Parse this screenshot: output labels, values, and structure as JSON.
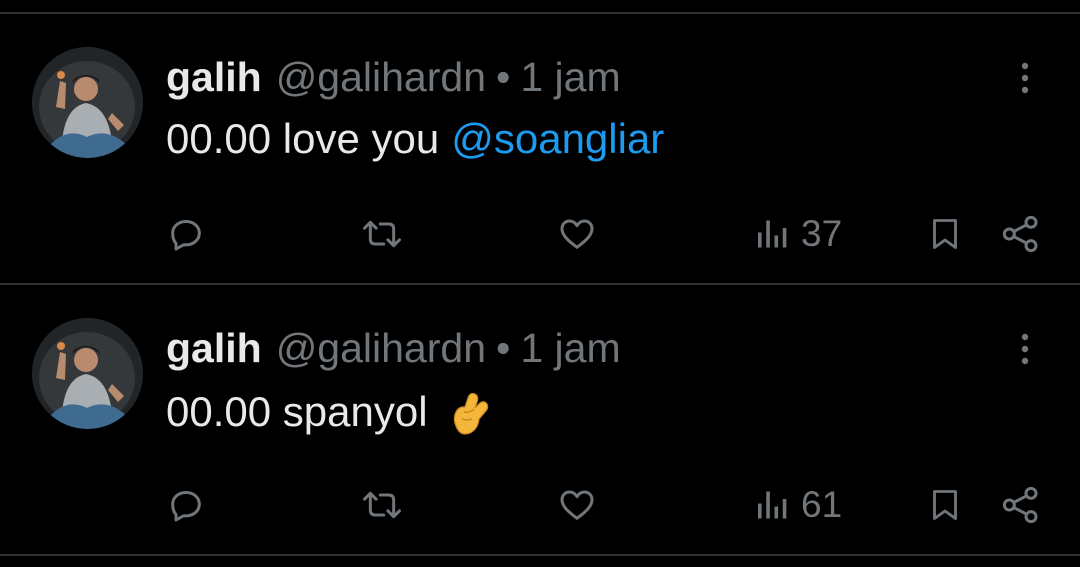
{
  "colors": {
    "background": "#000000",
    "text_primary": "#e7e9ea",
    "text_secondary": "#71767b",
    "accent": "#1d9bf0",
    "divider": "#2f3336"
  },
  "tweets": [
    {
      "author_name": "galih",
      "handle": "@galihardn",
      "separator": "•",
      "time": "1 jam",
      "text": "00.00 love you",
      "mention": "@soangliar",
      "emoji": "",
      "views": "37",
      "icons": [
        "reply-icon",
        "retweet-icon",
        "like-icon",
        "views-icon",
        "bookmark-icon",
        "share-icon",
        "more-icon"
      ]
    },
    {
      "author_name": "galih",
      "handle": "@galihardn",
      "separator": "•",
      "time": "1 jam",
      "text": "00.00 spanyol",
      "mention": "",
      "emoji": "🫰",
      "views": "61",
      "icons": [
        "reply-icon",
        "retweet-icon",
        "like-icon",
        "views-icon",
        "bookmark-icon",
        "share-icon",
        "more-icon"
      ]
    }
  ]
}
